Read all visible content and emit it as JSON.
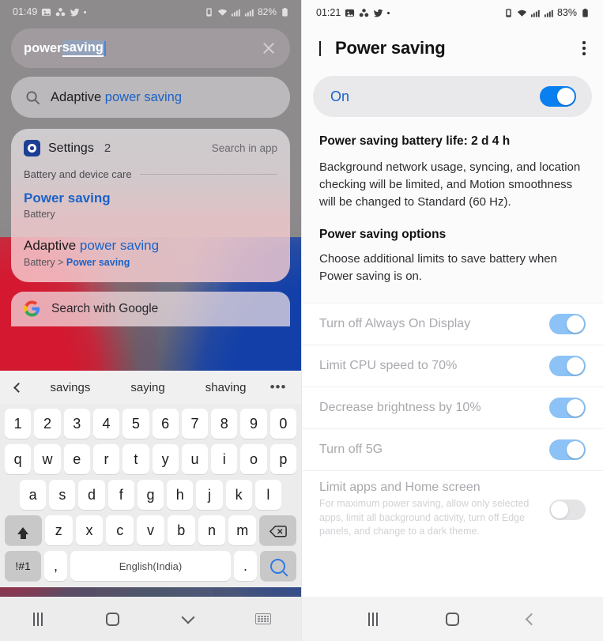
{
  "left": {
    "status": {
      "time": "01:49",
      "battery": "82%",
      "icons": [
        "gallery-icon",
        "contacts-icon",
        "twitter-icon",
        "dot-icon"
      ],
      "right_icons": [
        "alarm-icon",
        "wifi-icon",
        "signal1-icon",
        "signal2-icon"
      ]
    },
    "search": {
      "value_plain": "power ",
      "value_selected": "saving",
      "clear_label": "clear-icon"
    },
    "suggestion": {
      "prefix": "Adaptive ",
      "highlight": "power saving"
    },
    "card": {
      "app_name": "Settings",
      "count": "2",
      "search_in_app": "Search in app",
      "section": "Battery and device care",
      "results": [
        {
          "title_plain": "",
          "title_hl": "Power saving",
          "sub_plain": "Battery",
          "sub_hl": ""
        },
        {
          "title_plain": "Adaptive ",
          "title_hl": "power saving",
          "sub_plain": "Battery > ",
          "sub_hl": "Power saving"
        }
      ]
    },
    "google_row": {
      "label": "Search with Google",
      "icon": "google-logo-icon"
    },
    "predictions": {
      "back_icon": "chevron-left-icon",
      "items": [
        "savings",
        "saying",
        "shaving"
      ],
      "more": "•••"
    },
    "keyboard": {
      "row_numbers": [
        "1",
        "2",
        "3",
        "4",
        "5",
        "6",
        "7",
        "8",
        "9",
        "0"
      ],
      "row_top": [
        "q",
        "w",
        "e",
        "r",
        "t",
        "y",
        "u",
        "i",
        "o",
        "p"
      ],
      "row_home": [
        "a",
        "s",
        "d",
        "f",
        "g",
        "h",
        "j",
        "k",
        "l"
      ],
      "row_bottom": [
        "z",
        "x",
        "c",
        "v",
        "b",
        "n",
        "m"
      ],
      "shift_label": "shift-icon",
      "delete_label": "backspace-icon",
      "symbols_label": "!#1",
      "comma_label": ",",
      "space_label": "English(India)",
      "period_label": ".",
      "enter_label": "search-icon"
    },
    "navbar": [
      "recents-icon",
      "home-icon",
      "hide-keyboard-icon",
      "keyboard-switch-icon"
    ]
  },
  "right": {
    "status": {
      "time": "01:21",
      "battery": "83%",
      "icons": [
        "gallery-icon",
        "contacts-icon",
        "twitter-icon",
        "dot-icon"
      ],
      "right_icons": [
        "alarm-icon",
        "wifi-icon",
        "signal1-icon",
        "signal2-icon"
      ]
    },
    "appbar": {
      "back": "back-icon",
      "title": "Power saving",
      "menu": "more-options-icon"
    },
    "master": {
      "label": "On",
      "enabled": true
    },
    "info": {
      "battery_life_heading": "Power saving battery life: 2 d 4 h",
      "battery_life_body": "Background network usage, syncing, and location checking will be limited, and Motion smoothness will be changed to Standard (60 Hz).",
      "options_heading": "Power saving options",
      "options_body": "Choose additional limits to save battery when Power saving is on."
    },
    "options": [
      {
        "title": "Turn off Always On Display",
        "sub": "",
        "on": true
      },
      {
        "title": "Limit CPU speed to 70%",
        "sub": "",
        "on": true
      },
      {
        "title": "Decrease brightness by 10%",
        "sub": "",
        "on": true
      },
      {
        "title": "Turn off 5G",
        "sub": "",
        "on": true
      },
      {
        "title": "Limit apps and Home screen",
        "sub": "For maximum power saving, allow only selected apps, limit all background activity, turn off Edge panels, and change to a dark theme.",
        "on": false
      }
    ],
    "navbar": [
      "recents-icon",
      "home-icon",
      "back-icon"
    ]
  },
  "colors": {
    "accent_blue": "#1a62c8",
    "toggle_on": "#0a7ff0",
    "toggle_on_dim": "#8cc2f5",
    "toggle_off": "#e4e4e6"
  }
}
